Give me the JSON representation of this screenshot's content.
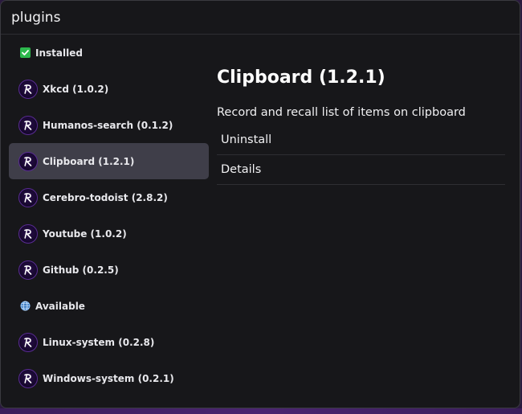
{
  "window": {
    "title": "plugins"
  },
  "sidebar": {
    "sections": [
      {
        "label": "Installed",
        "icon": "checkbox-checked-icon",
        "items": [
          {
            "label": "Xkcd (1.0.2)"
          },
          {
            "label": "Humanos-search (0.1.2)"
          },
          {
            "label": "Clipboard (1.2.1)",
            "selected": true
          },
          {
            "label": "Cerebro-todoist (2.8.2)"
          },
          {
            "label": "Youtube (1.0.2)"
          },
          {
            "label": "Github (0.2.5)"
          }
        ]
      },
      {
        "label": "Available",
        "icon": "globe-icon",
        "items": [
          {
            "label": "Linux-system (0.2.8)"
          },
          {
            "label": "Windows-system (0.2.1)"
          }
        ]
      }
    ]
  },
  "detail": {
    "title": "Clipboard (1.2.1)",
    "description": "Record and recall list of items on clipboard",
    "actions": [
      {
        "label": "Uninstall"
      },
      {
        "label": "Details"
      }
    ]
  },
  "colors": {
    "background": "#17171a",
    "selected_item": "#3f3e49",
    "installed_check": "#2db84d",
    "logo_accent": "#b47cff"
  }
}
